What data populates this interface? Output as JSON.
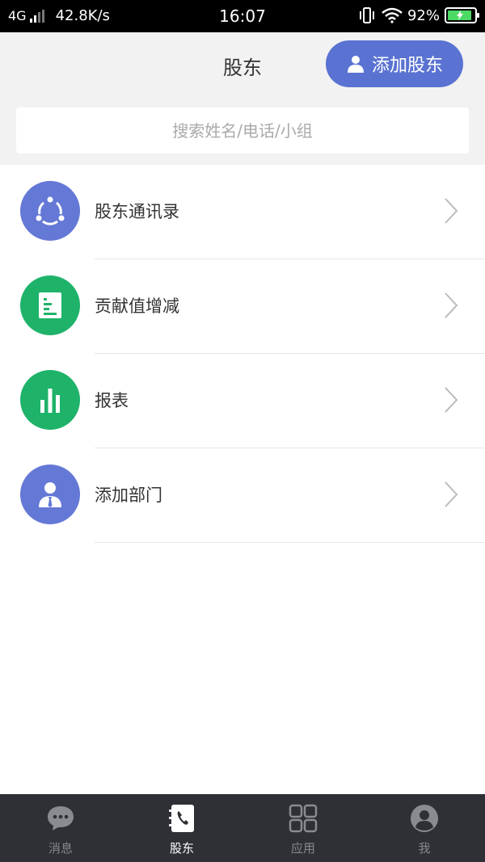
{
  "status_bar": {
    "network": "4G",
    "speed": "42.8K/s",
    "time": "16:07",
    "battery": "92%",
    "battery_level": 0.92
  },
  "header": {
    "title": "股东",
    "add_button_label": "添加股东"
  },
  "search": {
    "placeholder": "搜索姓名/电话/小组"
  },
  "menu": {
    "items": [
      {
        "label": "股东通讯录",
        "icon": "contacts-circle-icon",
        "color": "#6478d6"
      },
      {
        "label": "贡献值增减",
        "icon": "document-list-icon",
        "color": "#1fb36a"
      },
      {
        "label": "报表",
        "icon": "bar-chart-icon",
        "color": "#1fb36a"
      },
      {
        "label": "添加部门",
        "icon": "person-tie-icon",
        "color": "#6478d6"
      }
    ]
  },
  "tabbar": {
    "tabs": [
      {
        "label": "消息",
        "icon": "chat-bubble-icon",
        "active": false
      },
      {
        "label": "股东",
        "icon": "phone-book-icon",
        "active": true
      },
      {
        "label": "应用",
        "icon": "grid-apps-icon",
        "active": false
      },
      {
        "label": "我",
        "icon": "profile-icon",
        "active": false
      }
    ]
  },
  "colors": {
    "accent": "#5a73d2",
    "green": "#1fb36a",
    "tabbar_bg": "#2f3035"
  }
}
